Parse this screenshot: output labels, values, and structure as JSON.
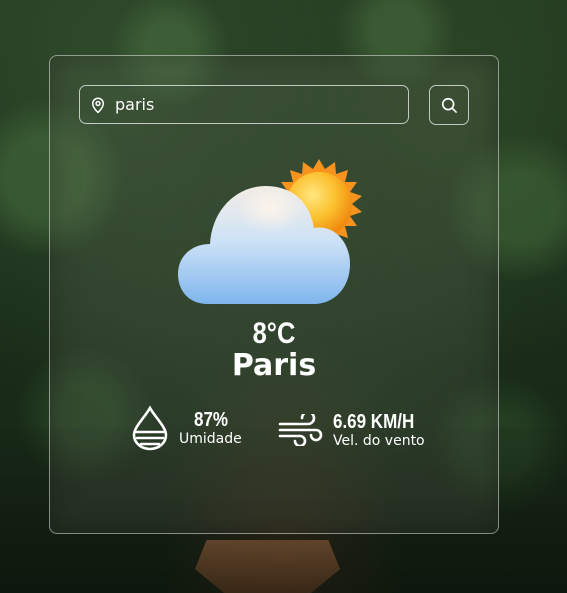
{
  "search": {
    "value": "paris",
    "pin_icon": "location-pin-icon",
    "button_icon": "search-icon"
  },
  "weather": {
    "icon": "partly-cloudy-icon",
    "temperature": "8°C",
    "city": "Paris"
  },
  "stats": {
    "humidity": {
      "icon": "water-drop-icon",
      "value": "87%",
      "label": "Umidade"
    },
    "wind": {
      "icon": "wind-icon",
      "value": "6.69 KM/H",
      "label": "Vel. do vento"
    }
  },
  "colors": {
    "text": "#ffffff",
    "sun": "#f5a623",
    "cloud": "#9cc9f2"
  }
}
